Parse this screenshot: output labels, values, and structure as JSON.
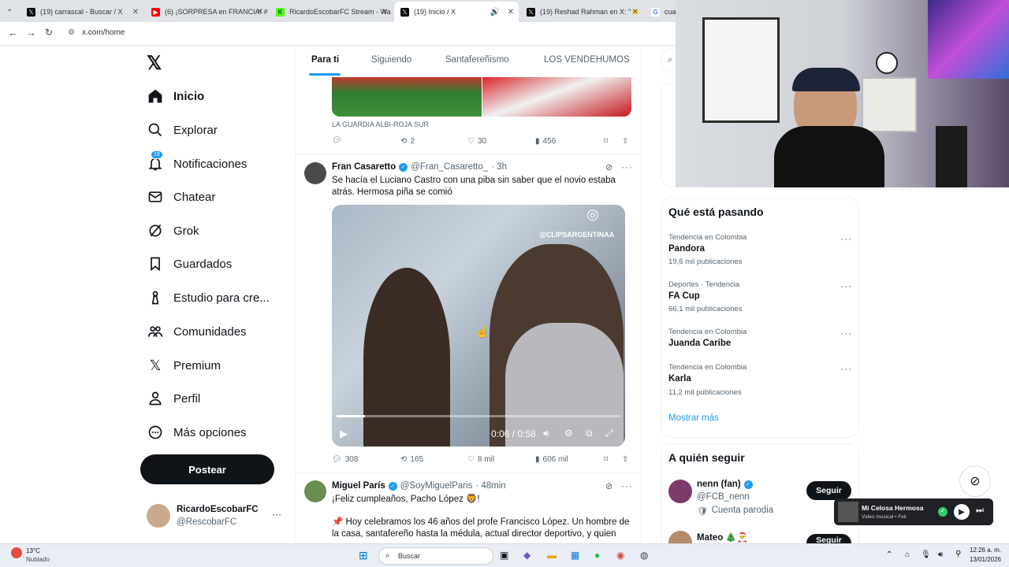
{
  "browser": {
    "tabs": [
      {
        "title": "(19) carrascal - Buscar / X",
        "icon": "x-logo-icon",
        "color": "#000000"
      },
      {
        "title": "(6) ¡SORPRESA en FRANCIA! #P",
        "icon": "youtube-icon",
        "color": "#ff0000"
      },
      {
        "title": "RicardoEscobarFC Stream - Wa",
        "icon": "kick-icon",
        "color": "#53fc18"
      },
      {
        "title": "(19) Inicio / X",
        "icon": "x-logo-icon",
        "color": "#000000"
      },
      {
        "title": "(19) Reshad Rahman en X: \"⭐",
        "icon": "x-logo-icon",
        "color": "#000000"
      },
      {
        "title": "cuan",
        "icon": "google-icon",
        "color": "#4285f4"
      }
    ],
    "url": "x.com/home"
  },
  "sidebar": {
    "items": [
      {
        "label": "Inicio",
        "icon": "home-icon"
      },
      {
        "label": "Explorar",
        "icon": "search-icon"
      },
      {
        "label": "Notificaciones",
        "icon": "bell-icon",
        "badge": "19"
      },
      {
        "label": "Chatear",
        "icon": "mail-icon"
      },
      {
        "label": "Grok",
        "icon": "grok-icon"
      },
      {
        "label": "Guardados",
        "icon": "bookmark-icon"
      },
      {
        "label": "Estudio para cre...",
        "icon": "studio-icon"
      },
      {
        "label": "Comunidades",
        "icon": "people-icon"
      },
      {
        "label": "Premium",
        "icon": "x-logo-icon"
      },
      {
        "label": "Perfil",
        "icon": "person-icon"
      },
      {
        "label": "Más opciones",
        "icon": "more-icon"
      }
    ],
    "post_label": "Postear",
    "account": {
      "name": "RicardoEscobarFC",
      "handle": "@RescobarFC"
    }
  },
  "feed": {
    "tabs": [
      "Para ti",
      "Siguiendo",
      "Santafereñismo",
      "LOS VENDEHUMOS"
    ],
    "tweets": [
      {
        "caption": "LA GUARDIA ALBI-ROJA SUR",
        "replies": "",
        "retweets": "2",
        "likes": "30",
        "views": "456"
      },
      {
        "name": "Fran Casaretto",
        "handle": "@Fran_Casaretto_",
        "time": "· 3h",
        "text": "Se hacía el Luciano Castro con una piba sin saber que el novio estaba atrás. Hermosa piña se comió",
        "video_watermark": "@CLIPSARGENTINAA",
        "video_time": "0:06 / 0:58",
        "video_progress": 0.1,
        "replies": "308",
        "retweets": "165",
        "likes": "8 mil",
        "views": "606 mil"
      },
      {
        "name": "Miguel París",
        "handle": "@SoyMiguelParis",
        "time": "· 48min",
        "text1": "¡Feliz cumpleaños, Pacho López 🦁!",
        "text2": "📌 Hoy celebramos los 46 años del profe Francisco López. Un hombre de la casa, santafereño hasta la médula, actual director deportivo, y quien"
      }
    ]
  },
  "right": {
    "trends_title": "Qué está pasando",
    "trends": [
      {
        "meta": "Tendencia en Colombia",
        "name": "Pandora",
        "count": "19,6 mil publicaciones"
      },
      {
        "meta": "Deportes · Tendencia",
        "name": "FA Cup",
        "count": "66,1 mil publicaciones"
      },
      {
        "meta": "Tendencia en Colombia",
        "name": "Juanda Caribe",
        "count": ""
      },
      {
        "meta": "Tendencia en Colombia",
        "name": "Karla",
        "count": "11,2 mil publicaciones"
      }
    ],
    "show_more": "Mostrar más",
    "follow_title": "A quién seguir",
    "follow": [
      {
        "name": "nenn (fan)",
        "handle": "@FCB_nenn",
        "note": "Cuenta parodia",
        "button": "Seguir"
      },
      {
        "name": "Mateo 🎄🎅",
        "handle": "",
        "note": "",
        "button": "Seguir"
      }
    ]
  },
  "media_popup": {
    "title": "Mi Celosa Hermosa",
    "subtitle": "Video musical • Feli"
  },
  "taskbar": {
    "weather_temp": "13°C",
    "weather_desc": "Nublado",
    "search_label": "Buscar",
    "time": "12:26 a. m.",
    "date": "13/01/2026"
  }
}
